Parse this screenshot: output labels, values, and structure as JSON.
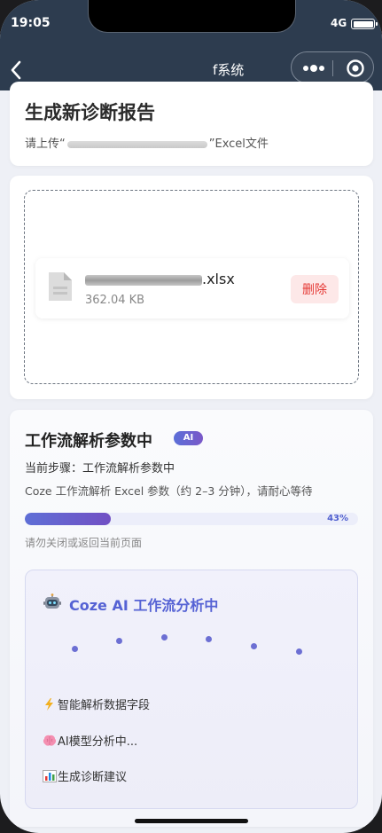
{
  "status_bar": {
    "time": "19:05",
    "network": "4G"
  },
  "nav": {
    "title": "f系统"
  },
  "upload_card": {
    "title": "生成新诊断报告",
    "subtitle_prefix": "请上传“",
    "subtitle_suffix": "”Excel文件"
  },
  "file": {
    "name_suffix": ".xlsx",
    "size": "362.04 KB",
    "delete_label": "删除"
  },
  "progress_card": {
    "title": "工作流解析参数中",
    "badge": "AI",
    "current_step": "当前步骤：工作流解析参数中",
    "description": "Coze 工作流解析 Excel 参数（约 2–3 分钟），请耐心等待",
    "progress_percent": 43,
    "progress_label": "43%",
    "warning": "请勿关闭或返回当前页面"
  },
  "ai_panel": {
    "title": "Coze AI 工作流分析中",
    "tasks": [
      {
        "icon": "lightning-icon",
        "label": "智能解析数据字段"
      },
      {
        "icon": "brain-icon",
        "label": "AI模型分析中..."
      },
      {
        "icon": "bar-chart-icon",
        "label": "生成诊断建议"
      }
    ]
  },
  "colors": {
    "header_bg": "#2d3c4f",
    "accent": "#5562d4",
    "danger": "#e53935"
  }
}
